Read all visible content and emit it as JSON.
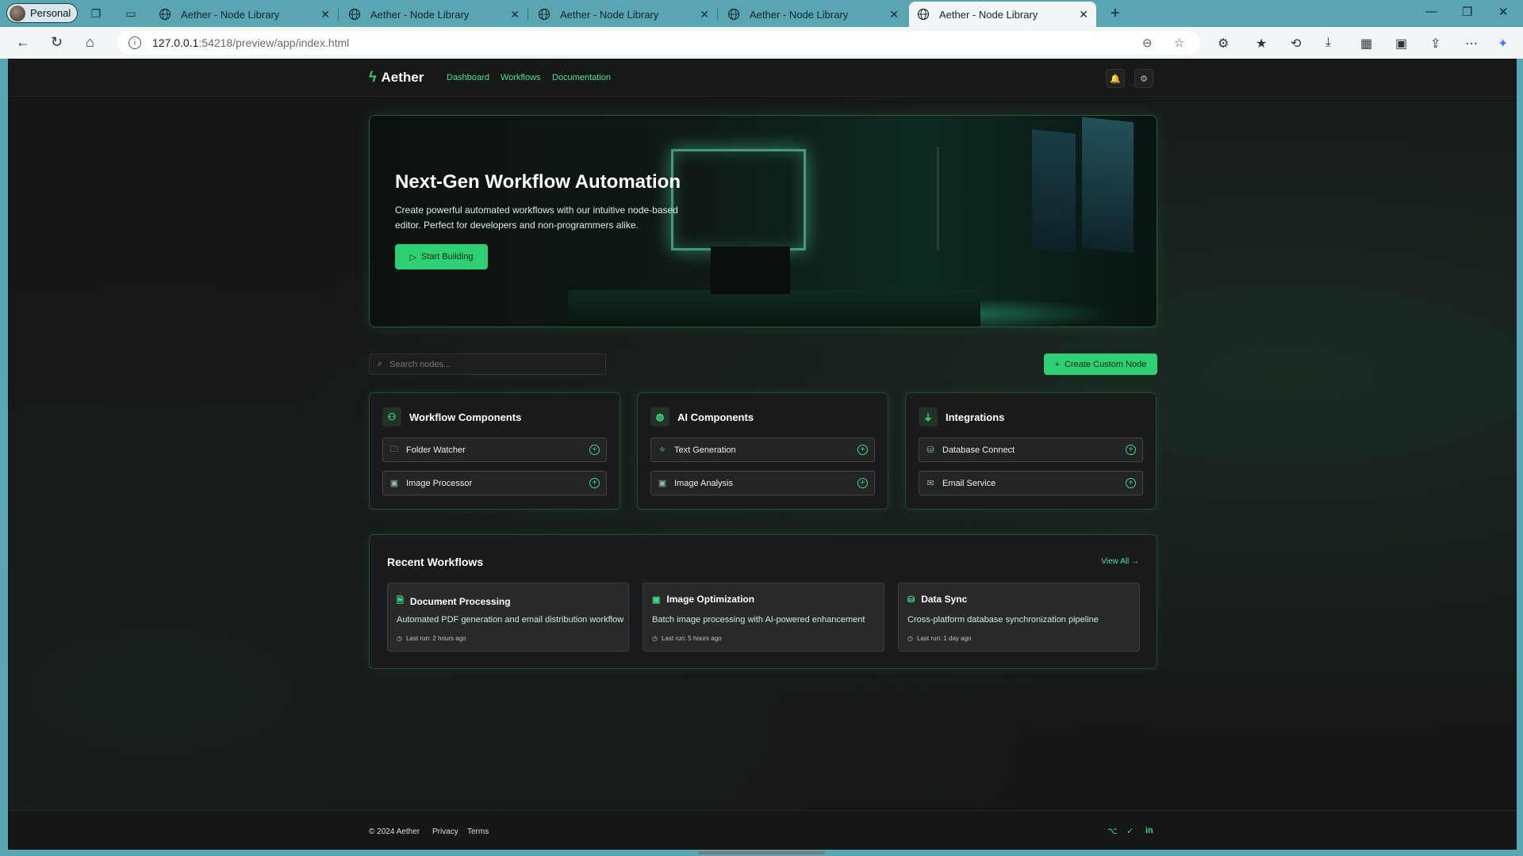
{
  "browser": {
    "profile": "Personal",
    "tabs": [
      {
        "title": "Aether - Node Library"
      },
      {
        "title": "Aether - Node Library"
      },
      {
        "title": "Aether - Node Library"
      },
      {
        "title": "Aether - Node Library"
      },
      {
        "title": "Aether - Node Library"
      }
    ],
    "url_host": "127.0.0.1",
    "url_rest": ":54218/preview/app/index.html"
  },
  "app": {
    "brand": "Aether",
    "nav": [
      "Dashboard",
      "Workflows",
      "Documentation"
    ]
  },
  "hero": {
    "title": "Next-Gen Workflow Automation",
    "description": "Create powerful automated workflows with our intuitive node-based editor. Perfect for developers and non-programmers alike.",
    "cta": "Start Building"
  },
  "search": {
    "placeholder": "Search nodes..."
  },
  "create_button": "Create Custom Node",
  "categories": [
    {
      "title": "Workflow Components",
      "items": [
        "Folder Watcher",
        "Image Processor"
      ]
    },
    {
      "title": "AI Components",
      "items": [
        "Text Generation",
        "Image Analysis"
      ]
    },
    {
      "title": "Integrations",
      "items": [
        "Database Connect",
        "Email Service"
      ]
    }
  ],
  "recent": {
    "title": "Recent Workflows",
    "view_all": "View All",
    "workflows": [
      {
        "name": "Document Processing",
        "desc": "Automated PDF generation and email distribution workflow",
        "last_run": "Last run: 2 hours ago"
      },
      {
        "name": "Image Optimization",
        "desc": "Batch image processing with AI-powered enhancement",
        "last_run": "Last run: 5 hours ago"
      },
      {
        "name": "Data Sync",
        "desc": "Cross-platform database synchronization pipeline",
        "last_run": "Last run: 1 day ago"
      }
    ]
  },
  "footer": {
    "copyright": "© 2024 Aether",
    "links": [
      "Privacy",
      "Terms"
    ]
  },
  "colors": {
    "accent": "#2fcf75",
    "background": "#151617",
    "browser_frame": "#5aa5b3"
  }
}
